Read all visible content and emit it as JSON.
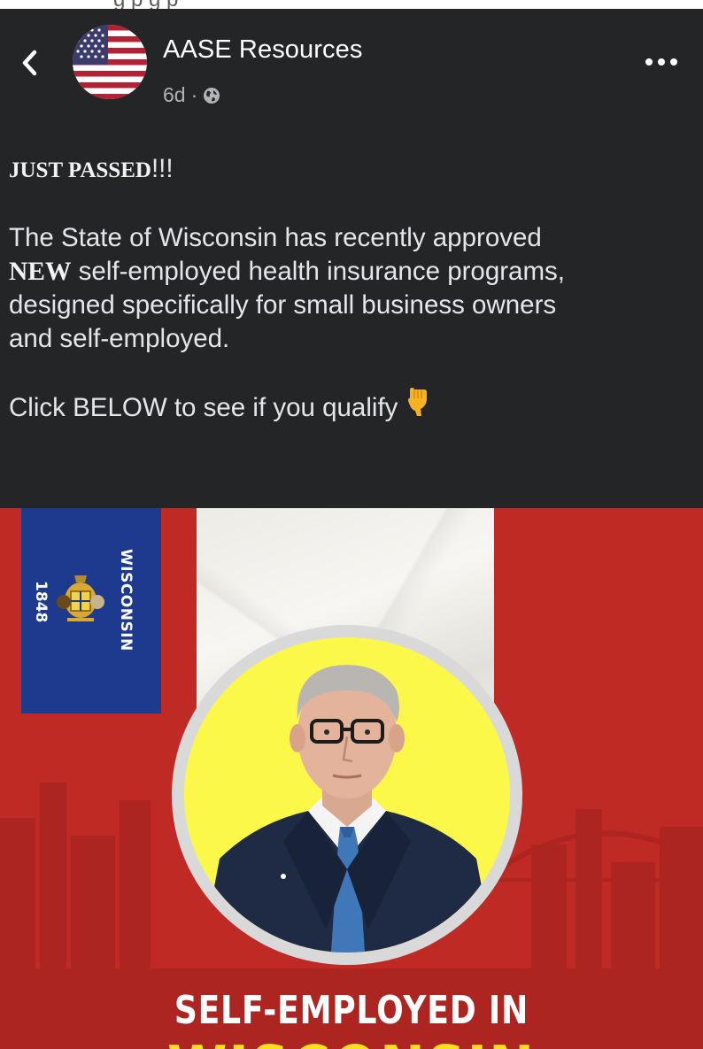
{
  "top_strip": {
    "clipped_text": "g  p  g                                p"
  },
  "post": {
    "page_name": "AASE Resources",
    "time": "6d",
    "separator": "·",
    "headline_bold": "JUST PASSED",
    "headline_rest": "!!!",
    "line1": "The State of Wisconsin has recently approved",
    "line2_bold": "NEW",
    "line2_rest": " self-employed health insurance programs,",
    "line3": "designed specifically for small business owners",
    "line4": "and self-employed.",
    "cta": "Click BELOW to see if you qualify"
  },
  "icons": {
    "back": "chevron-left-icon",
    "avatar": "us-flag-avatar",
    "audience": "globe-icon",
    "more": "ellipsis-icon",
    "emoji": "backhand-index-pointing-down"
  },
  "ad": {
    "flag_state": "WISCONSIN",
    "flag_year": "1848",
    "title": "SELF-EMPLOYED IN",
    "subtitle": "WISCONSIN"
  },
  "colors": {
    "post_bg": "#242526",
    "ad_red": "#bf2a25",
    "flag_blue": "#1e3a8e",
    "portrait_yellow": "#fbf84a",
    "title_yellow": "#f7e11a"
  }
}
